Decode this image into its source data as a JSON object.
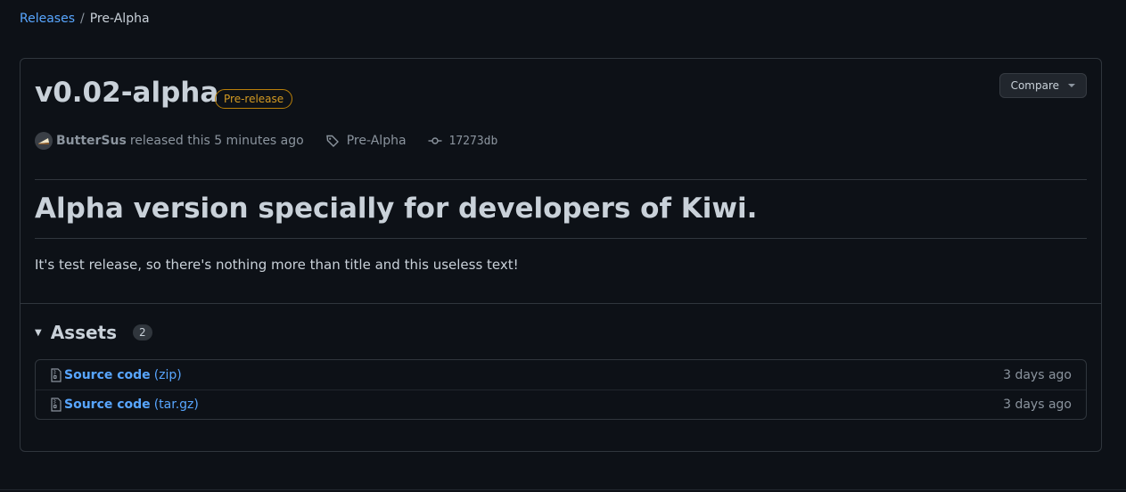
{
  "breadcrumb": {
    "releases_link": "Releases",
    "separator": "/",
    "current": "Pre-Alpha"
  },
  "release": {
    "title": "v0.02-alpha",
    "badge": "Pre-release",
    "compare_label": "Compare",
    "author": "ButterSus",
    "released_text": "released this 5 minutes ago",
    "tag": "Pre-Alpha",
    "commit": "17273db"
  },
  "body": {
    "heading": "Alpha version specially for developers of Kiwi.",
    "paragraph": "It's test release, so there's nothing more than title and this useless text!"
  },
  "assets": {
    "title": "Assets",
    "count": "2",
    "items": [
      {
        "name": "Source code",
        "ext": "(zip)",
        "date": "3 days ago"
      },
      {
        "name": "Source code",
        "ext": "(tar.gz)",
        "date": "3 days ago"
      }
    ]
  },
  "colors": {
    "background": "#0d1117",
    "link": "#58a6ff",
    "prerelease": "#d29922",
    "border": "#30363d"
  },
  "icons": {
    "tag": "tag-icon",
    "commit": "commit-icon",
    "zip": "file-zip-icon",
    "disclosure": "triangle-down-icon"
  }
}
